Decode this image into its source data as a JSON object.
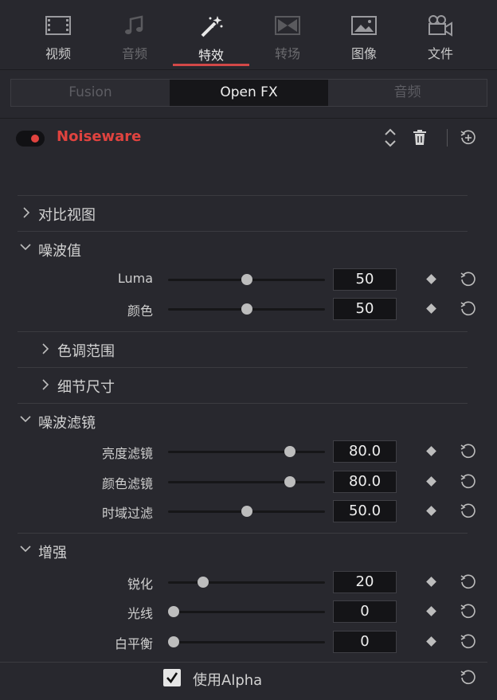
{
  "tabs": [
    {
      "label": "视频",
      "icon": "film-icon",
      "state": "normal"
    },
    {
      "label": "音频",
      "icon": "music-note-icon",
      "state": "disabled"
    },
    {
      "label": "特效",
      "icon": "magic-wand-icon",
      "state": "active"
    },
    {
      "label": "转场",
      "icon": "transition-icon",
      "state": "disabled"
    },
    {
      "label": "图像",
      "icon": "image-icon",
      "state": "normal"
    },
    {
      "label": "文件",
      "icon": "camera-icon",
      "state": "normal"
    }
  ],
  "segments": [
    {
      "label": "Fusion",
      "active": false
    },
    {
      "label": "Open FX",
      "active": true
    },
    {
      "label": "音频",
      "active": false
    }
  ],
  "plugin": {
    "name": "Noiseware",
    "enabled": true
  },
  "sections": {
    "compare_view": "对比视图",
    "noise_level": "噪波值",
    "tone_range": "色调范围",
    "detail_size": "细节尺寸",
    "noise_filter": "噪波滤镜",
    "enhance": "增强"
  },
  "params": {
    "luma": {
      "label": "Luma",
      "value": "50",
      "fraction": 0.5
    },
    "color": {
      "label": "颜色",
      "value": "50",
      "fraction": 0.5
    },
    "luma_filter": {
      "label": "亮度滤镜",
      "value": "80.0",
      "fraction": 0.8
    },
    "color_filter": {
      "label": "颜色滤镜",
      "value": "80.0",
      "fraction": 0.8
    },
    "temporal_filter": {
      "label": "时域过滤",
      "value": "50.0",
      "fraction": 0.5
    },
    "sharpen": {
      "label": "锐化",
      "value": "20",
      "fraction": 0.2
    },
    "light": {
      "label": "光线",
      "value": "0",
      "fraction": 0.0
    },
    "white_balance": {
      "label": "白平衡",
      "value": "0",
      "fraction": 0.0
    }
  },
  "use_alpha": {
    "label": "使用Alpha",
    "checked": true
  },
  "colors": {
    "accent": "#e0433f",
    "panel": "#28282e",
    "field": "#141417"
  }
}
